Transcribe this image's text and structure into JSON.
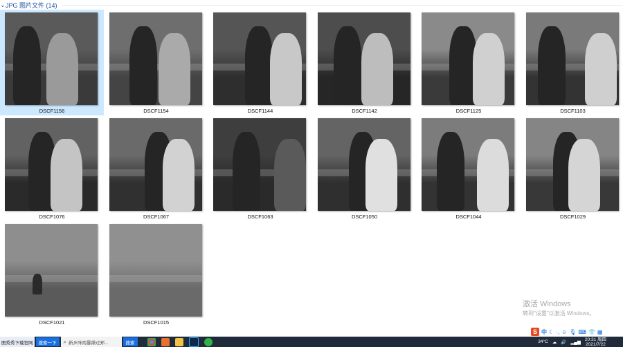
{
  "group": {
    "chevron": "⌄",
    "title": "JPG 图片文件 (14)"
  },
  "files": [
    {
      "name": "DSCF1156",
      "selected": true
    },
    {
      "name": "DSCF1154",
      "selected": false
    },
    {
      "name": "DSCF1144",
      "selected": false
    },
    {
      "name": "DSCF1142",
      "selected": false
    },
    {
      "name": "DSCF1125",
      "selected": false
    },
    {
      "name": "DSCF1103",
      "selected": false
    },
    {
      "name": "DSCF1076",
      "selected": false
    },
    {
      "name": "DSCF1067",
      "selected": false
    },
    {
      "name": "DSCF1063",
      "selected": false
    },
    {
      "name": "DSCF1050",
      "selected": false
    },
    {
      "name": "DSCF1044",
      "selected": false
    },
    {
      "name": "DSCF1029",
      "selected": false
    },
    {
      "name": "DSCF1021",
      "selected": false
    },
    {
      "name": "DSCF1015",
      "selected": false
    }
  ],
  "watermark": {
    "line1": "激活 Windows",
    "line2": "转到\"设置\"以激活 Windows。"
  },
  "ime": {
    "logo": "S",
    "mode": "中"
  },
  "taskbar": {
    "site_label": "图秀秀下载官网",
    "search_next": "搜索一下",
    "search_placeholder": "新乡阵雨暴躁过郑...",
    "search_button": "搜索",
    "weather_temp": "34°C",
    "time": "20:31 周四",
    "date": "2021/7/22"
  },
  "colors": {
    "accent": "#1e4e9c",
    "selection": "#cce8ff",
    "taskbar": "#1f2b3b"
  }
}
